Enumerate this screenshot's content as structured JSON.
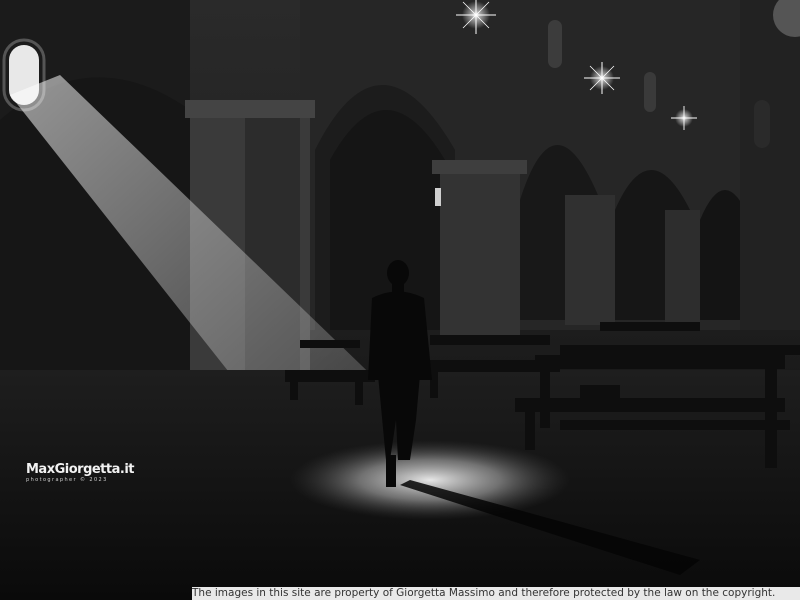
{
  "watermark": {
    "name": "MaxGiorgetta.it",
    "subtitle": "photographer © 2023"
  },
  "footer": {
    "copyright": "The images in this site are property of Giorgetta Massimo and therefore protected by the law on the copyright."
  }
}
